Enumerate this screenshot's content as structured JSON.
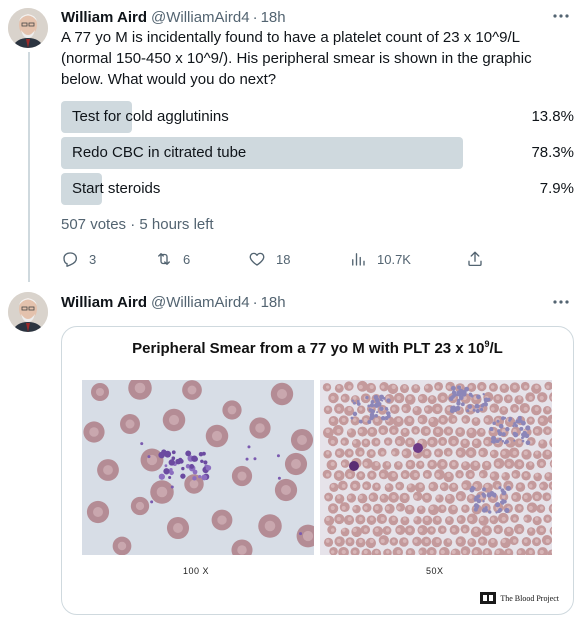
{
  "colors": {
    "text": "#0f1419",
    "muted": "#536471",
    "bar": "#cfd9de",
    "border": "#cfd9de"
  },
  "tweet1": {
    "name": "William Aird",
    "handle": "@WilliamAird4",
    "separator": "·",
    "time": "18h",
    "text": "A 77 yo M is incidentally found to have a platelet count of 23 x 10^9/L (normal 150-450 x 10^9/). His peripheral smear is shown in the graphic below. What would you do next?",
    "poll": {
      "options": [
        {
          "label": "Test for cold agglutinins",
          "percent_text": "13.8%",
          "percent": 13.8
        },
        {
          "label": "Redo CBC in citrated tube",
          "percent_text": "78.3%",
          "percent": 78.3
        },
        {
          "label": "Start steroids",
          "percent_text": "7.9%",
          "percent": 7.9
        }
      ],
      "meta": "507 votes · 5 hours left"
    },
    "actions": {
      "reply": {
        "icon": "reply-icon",
        "count": "3"
      },
      "retweet": {
        "icon": "retweet-icon",
        "count": "6"
      },
      "like": {
        "icon": "heart-icon",
        "count": "18"
      },
      "views": {
        "icon": "analytics-icon",
        "count": "10.7K"
      },
      "share": {
        "icon": "share-icon"
      }
    }
  },
  "tweet2": {
    "name": "William Aird",
    "handle": "@WilliamAird4",
    "separator": "·",
    "time": "18h",
    "card": {
      "title_prefix": "Peripheral Smear from a 77 yo M with PLT 23 x 10",
      "title_sup": "9",
      "title_suffix": "/L",
      "caption_left": "100 X",
      "caption_right": "50X",
      "brand": "The Blood Project"
    }
  }
}
